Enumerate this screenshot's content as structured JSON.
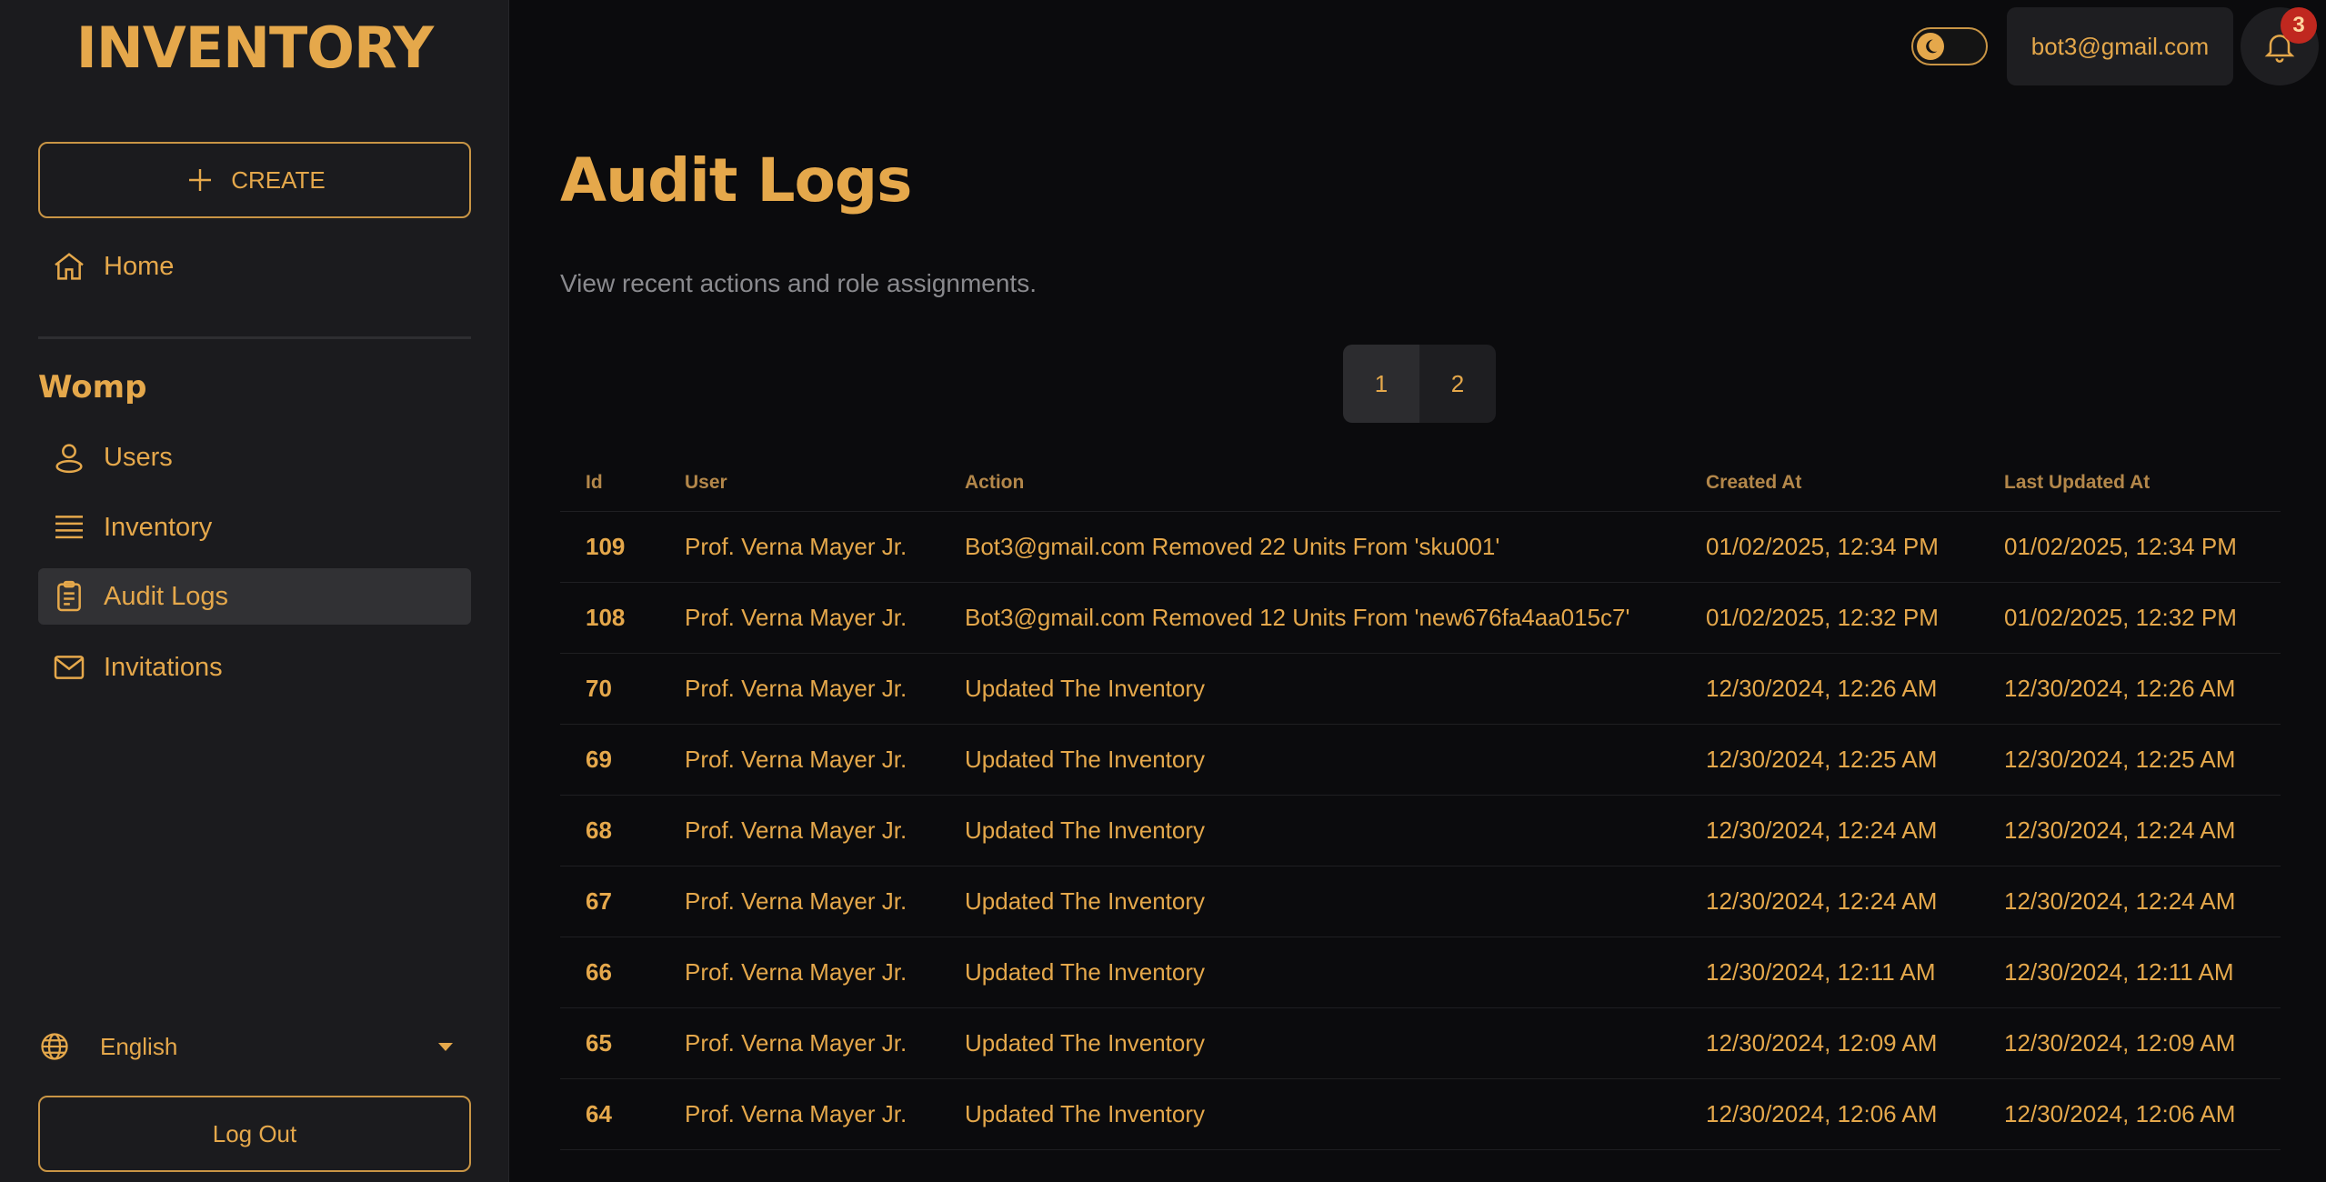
{
  "app": {
    "brand": "INVENTORY"
  },
  "sidebar": {
    "create_label": "CREATE",
    "home_label": "Home",
    "section_title": "Womp",
    "items": [
      {
        "label": "Users",
        "icon": "user-icon"
      },
      {
        "label": "Inventory",
        "icon": "list-icon"
      },
      {
        "label": "Audit Logs",
        "icon": "clipboard-icon"
      },
      {
        "label": "Invitations",
        "icon": "mail-icon"
      }
    ],
    "language": "English",
    "logout_label": "Log Out"
  },
  "header": {
    "theme_toggle": "dark-mode-toggle",
    "user_email": "bot3@gmail.com",
    "notification_count": "3"
  },
  "page": {
    "title": "Audit Logs",
    "subtitle": "View recent actions and role assignments.",
    "pages": [
      "1",
      "2"
    ]
  },
  "table": {
    "columns": [
      "Id",
      "User",
      "Action",
      "Created At",
      "Last Updated At"
    ],
    "rows": [
      [
        "109",
        "Prof. Verna Mayer Jr.",
        "Bot3@gmail.com Removed 22 Units From 'sku001'",
        "01/02/2025, 12:34 PM",
        "01/02/2025, 12:34 PM"
      ],
      [
        "108",
        "Prof. Verna Mayer Jr.",
        "Bot3@gmail.com Removed 12 Units From 'new676fa4aa015c7'",
        "01/02/2025, 12:32 PM",
        "01/02/2025, 12:32 PM"
      ],
      [
        "70",
        "Prof. Verna Mayer Jr.",
        "Updated The Inventory",
        "12/30/2024, 12:26 AM",
        "12/30/2024, 12:26 AM"
      ],
      [
        "69",
        "Prof. Verna Mayer Jr.",
        "Updated The Inventory",
        "12/30/2024, 12:25 AM",
        "12/30/2024, 12:25 AM"
      ],
      [
        "68",
        "Prof. Verna Mayer Jr.",
        "Updated The Inventory",
        "12/30/2024, 12:24 AM",
        "12/30/2024, 12:24 AM"
      ],
      [
        "67",
        "Prof. Verna Mayer Jr.",
        "Updated The Inventory",
        "12/30/2024, 12:24 AM",
        "12/30/2024, 12:24 AM"
      ],
      [
        "66",
        "Prof. Verna Mayer Jr.",
        "Updated The Inventory",
        "12/30/2024, 12:11 AM",
        "12/30/2024, 12:11 AM"
      ],
      [
        "65",
        "Prof. Verna Mayer Jr.",
        "Updated The Inventory",
        "12/30/2024, 12:09 AM",
        "12/30/2024, 12:09 AM"
      ],
      [
        "64",
        "Prof. Verna Mayer Jr.",
        "Updated The Inventory",
        "12/30/2024, 12:06 AM",
        "12/30/2024, 12:06 AM"
      ]
    ]
  },
  "colors": {
    "accent": "#e5a84b",
    "background": "#0b0b0d",
    "sidebar": "#1b1b1e",
    "badge": "#c0281f"
  }
}
